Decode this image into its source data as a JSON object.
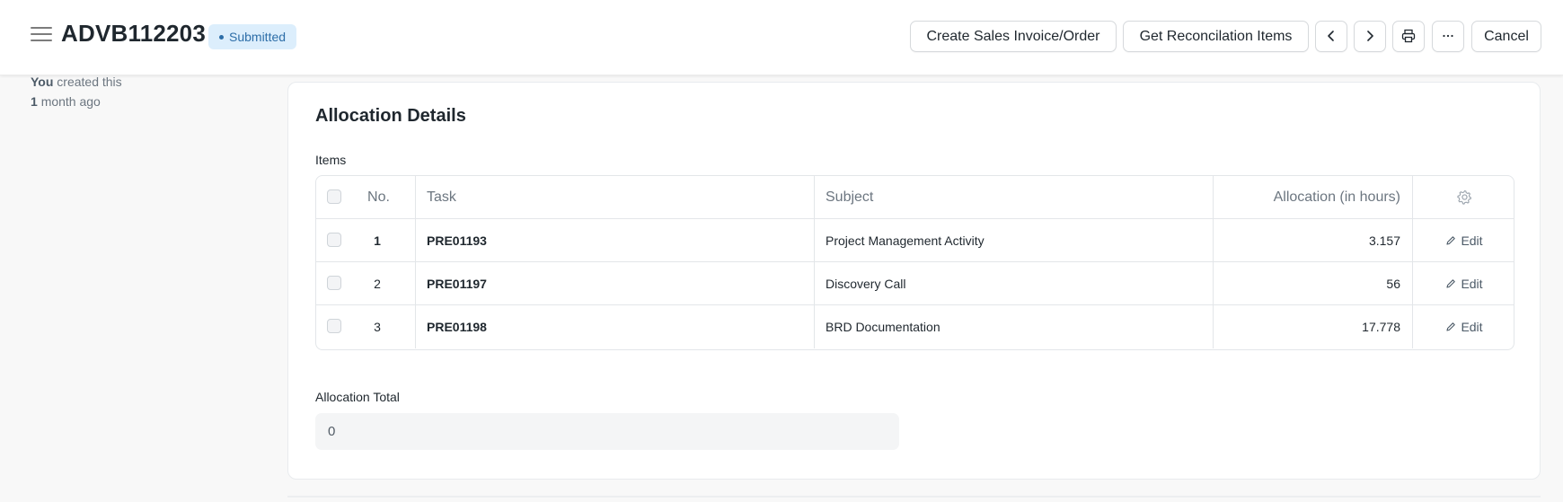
{
  "header": {
    "title": "ADVB112203",
    "status": "Submitted",
    "buttons": {
      "create": "Create Sales Invoice/Order",
      "reconcile": "Get Reconcilation Items",
      "cancel": "Cancel"
    },
    "icons": [
      "hamburger-icon",
      "chevron-left-icon",
      "chevron-right-icon",
      "printer-icon",
      "more-icon"
    ]
  },
  "sidebar": {
    "actor": "You",
    "action": "created this",
    "count": "1",
    "ago": "month ago"
  },
  "section": {
    "title": "Allocation Details",
    "items_label": "Items",
    "columns": {
      "no": "No.",
      "task": "Task",
      "subject": "Subject",
      "allocation": "Allocation (in hours)"
    },
    "rows": [
      {
        "no": "1",
        "task": "PRE01193",
        "subject": "Project Management Activity",
        "allocation": "3.157",
        "action": "Edit"
      },
      {
        "no": "2",
        "task": "PRE01197",
        "subject": "Discovery Call",
        "allocation": "56",
        "action": "Edit"
      },
      {
        "no": "3",
        "task": "PRE01198",
        "subject": "BRD Documentation",
        "allocation": "17.778",
        "action": "Edit"
      }
    ],
    "total_label": "Allocation Total",
    "total_value": "0"
  },
  "colors": {
    "badge_bg": "#dceefc",
    "badge_text": "#2d6ea8",
    "border": "#e3e6e9"
  }
}
